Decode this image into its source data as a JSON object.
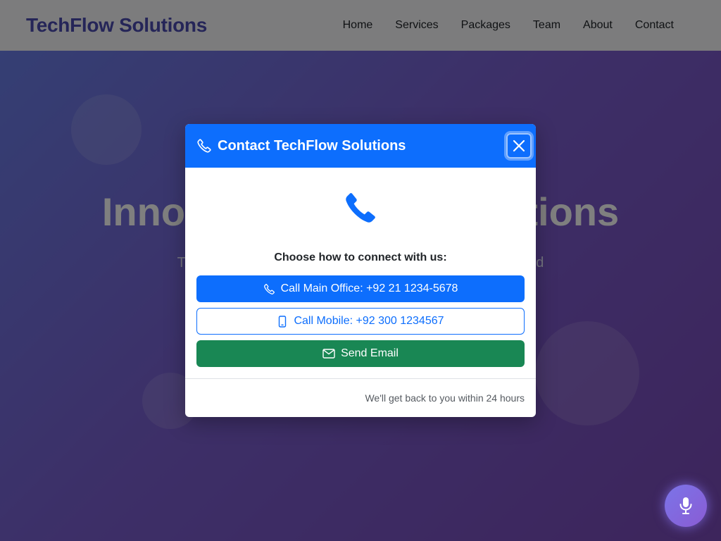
{
  "navbar": {
    "brand": "TechFlow Solutions",
    "links": [
      "Home",
      "Services",
      "Packages",
      "Team",
      "About",
      "Contact"
    ]
  },
  "hero": {
    "title": "Innovative Digital Solutions",
    "subtitle": "Transforming businesses with cutting-edge technology and"
  },
  "modal": {
    "title": "Contact TechFlow Solutions",
    "prompt": "Choose how to connect with us:",
    "buttons": {
      "office": "Call Main Office: +92 21 1234-5678",
      "mobile": "Call Mobile: +92 300 1234567",
      "email": "Send Email"
    },
    "footer": "We'll get back to you within 24 hours"
  },
  "icons": {
    "header": "phone-icon",
    "close": "close-icon",
    "hero_icon": "phone-icon",
    "office": "phone-icon",
    "mobile": "mobile-phone-icon",
    "email": "envelope-icon",
    "fab": "microphone-icon"
  },
  "colors": {
    "primary": "#0d6efd",
    "success": "#198754",
    "brand": "#4a4ab0"
  }
}
